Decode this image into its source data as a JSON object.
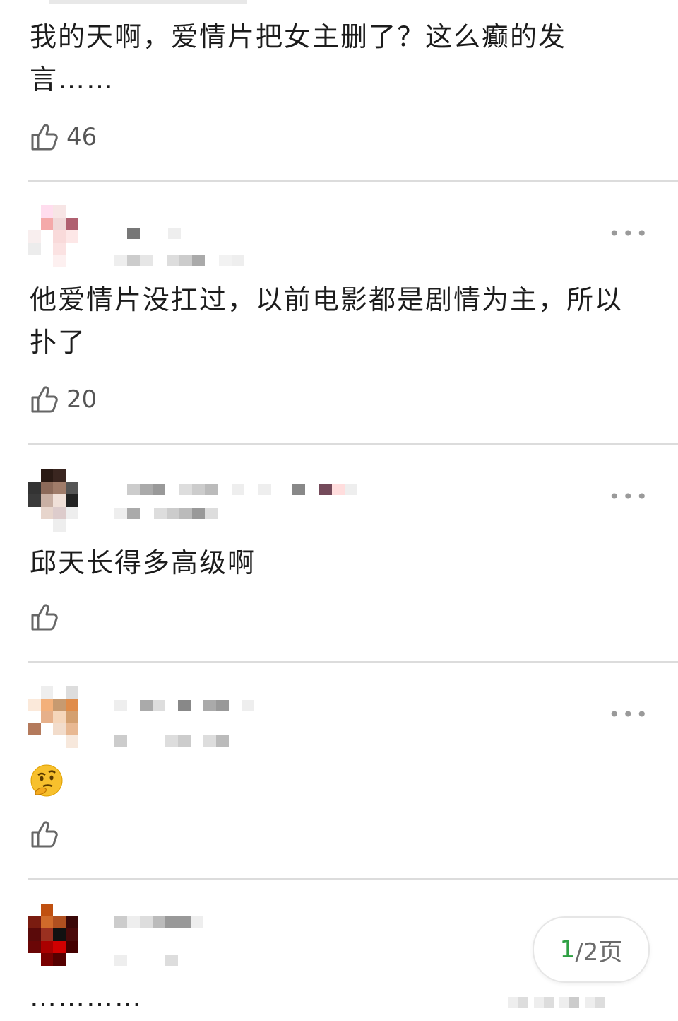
{
  "comments": [
    {
      "text": "我的天啊，爱情片把女主删了？这么癫的发言……",
      "likes": "46"
    },
    {
      "text": "他爱情片没扛过，以前电影都是剧情为主，所以扑了",
      "likes": "20"
    },
    {
      "text": "邱天长得多高级啊",
      "likes": ""
    },
    {
      "text": "",
      "likes": "",
      "emoji": "thinking-face"
    },
    {
      "text": "…………"
    }
  ],
  "pager": {
    "current": "1",
    "rest": "/2页"
  },
  "icons": {
    "like": "thumbs-up-icon",
    "more": "more-dots-icon"
  }
}
